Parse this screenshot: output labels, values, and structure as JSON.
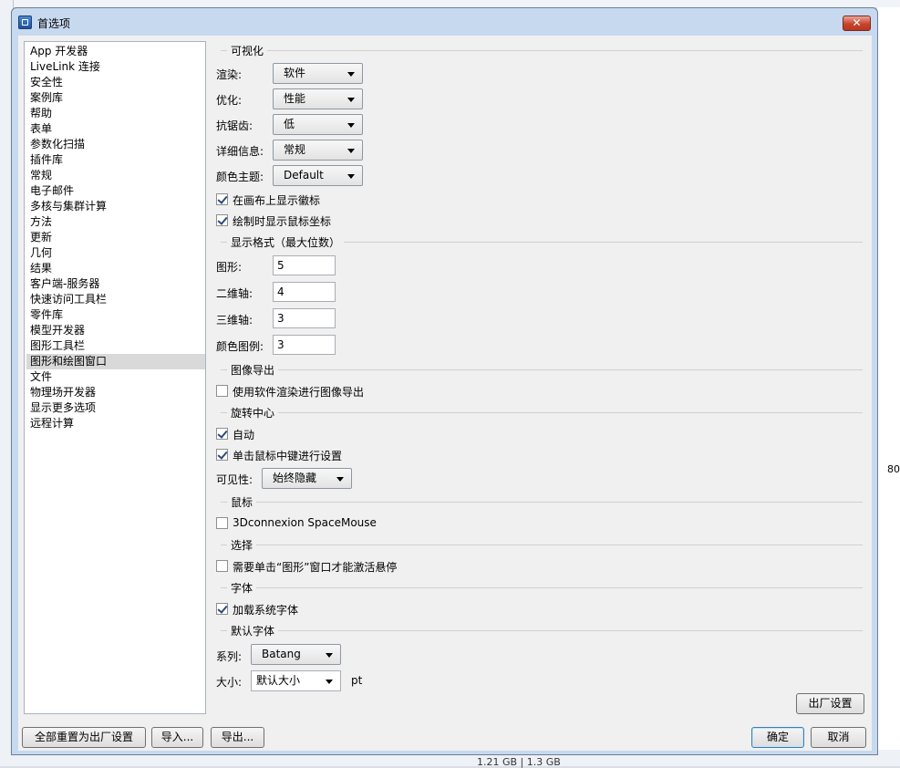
{
  "background": {
    "status_text": "1.21 GB | 1.3 GB",
    "side_value": "80"
  },
  "dialog": {
    "title": "首选项",
    "close_glyph": "✕"
  },
  "categories": [
    "App 开发器",
    "LiveLink 连接",
    "安全性",
    "案例库",
    "帮助",
    "表单",
    "参数化扫描",
    "插件库",
    "常规",
    "电子邮件",
    "多核与集群计算",
    "方法",
    "更新",
    "几何",
    "结果",
    "客户端-服务器",
    "快速访问工具栏",
    "零件库",
    "模型开发器",
    "图形工具栏",
    "图形和绘图窗口",
    "文件",
    "物理场开发器",
    "显示更多选项",
    "远程计算"
  ],
  "selected_category": "图形和绘图窗口",
  "sections": {
    "visualization": "可视化",
    "display_format": "显示格式（最大位数）",
    "image_export": "图像导出",
    "rotation_center": "旋转中心",
    "mouse": "鼠标",
    "selection": "选择",
    "fonts": "字体",
    "default_font": "默认字体"
  },
  "visualization": {
    "render_label": "渲染:",
    "render_value": "软件",
    "optimize_label": "优化:",
    "optimize_value": "性能",
    "antialias_label": "抗锯齿:",
    "antialias_value": "低",
    "detail_label": "详细信息:",
    "detail_value": "常规",
    "theme_label": "颜色主题:",
    "theme_value": "Default",
    "show_axes_label": "在画布上显示徽标",
    "show_axes_checked": true,
    "show_mouse_coords_label": "绘制时显示鼠标坐标",
    "show_mouse_coords_checked": true
  },
  "display_format": {
    "graphics_label": "图形:",
    "graphics_value": "5",
    "axis2d_label": "二维轴:",
    "axis2d_value": "4",
    "axis3d_label": "三维轴:",
    "axis3d_value": "3",
    "color_legend_label": "颜色图例:",
    "color_legend_value": "3"
  },
  "image_export": {
    "software_render_label": "使用软件渲染进行图像导出",
    "software_render_checked": false
  },
  "rotation_center": {
    "auto_label": "自动",
    "auto_checked": true,
    "middle_click_label": "单击鼠标中键进行设置",
    "middle_click_checked": true,
    "visibility_label": "可见性:",
    "visibility_value": "始终隐藏"
  },
  "mouse": {
    "spacemouse_label": "3Dconnexion SpaceMouse",
    "spacemouse_checked": false
  },
  "selection": {
    "hover_label": "需要单击“图形”窗口才能激活悬停",
    "hover_checked": false
  },
  "fonts": {
    "load_system_label": "加载系统字体",
    "load_system_checked": true
  },
  "default_font": {
    "family_label": "系列:",
    "family_value": "Batang",
    "size_label": "大小:",
    "size_value": "默认大小",
    "size_unit": "pt"
  },
  "buttons": {
    "factory_reset_page": "出厂设置",
    "reset_all": "全部重置为出厂设置",
    "import": "导入...",
    "export": "导出...",
    "ok": "确定",
    "cancel": "取消"
  }
}
